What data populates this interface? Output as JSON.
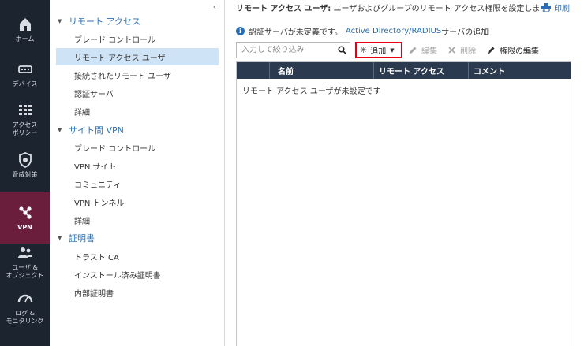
{
  "rail": {
    "items": [
      {
        "label": "ホーム",
        "icon": "home-icon"
      },
      {
        "label": "デバイス",
        "icon": "device-icon"
      },
      {
        "label": "アクセス\nポリシー",
        "icon": "access-policy-icon"
      },
      {
        "label": "脅威対策",
        "icon": "shield-icon"
      },
      {
        "label": "VPN",
        "icon": "vpn-network-icon"
      },
      {
        "label": "ユーザ &\nオブジェクト",
        "icon": "users-icon"
      },
      {
        "label": "ログ &\nモニタリング",
        "icon": "monitoring-gauge-icon"
      }
    ],
    "active_index": 4
  },
  "nav": {
    "sections": [
      {
        "title": "リモート アクセス",
        "items": [
          "ブレード コントロール",
          "リモート アクセス ユーザ",
          "接続されたリモート ユーザ",
          "認証サーバ",
          "詳細"
        ]
      },
      {
        "title": "サイト間 VPN",
        "items": [
          "ブレード コントロール",
          "VPN サイト",
          "コミュニティ",
          "VPN トンネル",
          "詳細"
        ]
      },
      {
        "title": "証明書",
        "items": [
          "トラスト CA",
          "インストール済み証明書",
          "内部証明書"
        ]
      }
    ],
    "selected": "リモート アクセス ユーザ"
  },
  "header": {
    "title": "リモート アクセス ユーザ:",
    "description": " ユーザおよびグループのリモート アクセス権限を設定します。",
    "print_label": "印刷"
  },
  "info": {
    "text_before": "認証サーバが未定義です。",
    "link1": "Active Directory",
    "separator": "/",
    "link2": "RADIUS",
    "text_after": " サーバの追加"
  },
  "toolbar": {
    "search_placeholder": "入力して絞り込み",
    "add_label": "追加",
    "edit_label": "編集",
    "delete_label": "削除",
    "edit_permissions_label": "権限の編集"
  },
  "table": {
    "columns": [
      "",
      "名前",
      "リモート アクセス",
      "コメント"
    ],
    "empty_message": "リモート アクセス ユーザが未設定です"
  },
  "colors": {
    "rail_bg": "#1c2430",
    "rail_active": "#6a1e3c",
    "link": "#2a6fb5",
    "selected_row": "#cfe3f6",
    "table_header": "#2b3a4e",
    "highlight_border": "#e60012"
  }
}
